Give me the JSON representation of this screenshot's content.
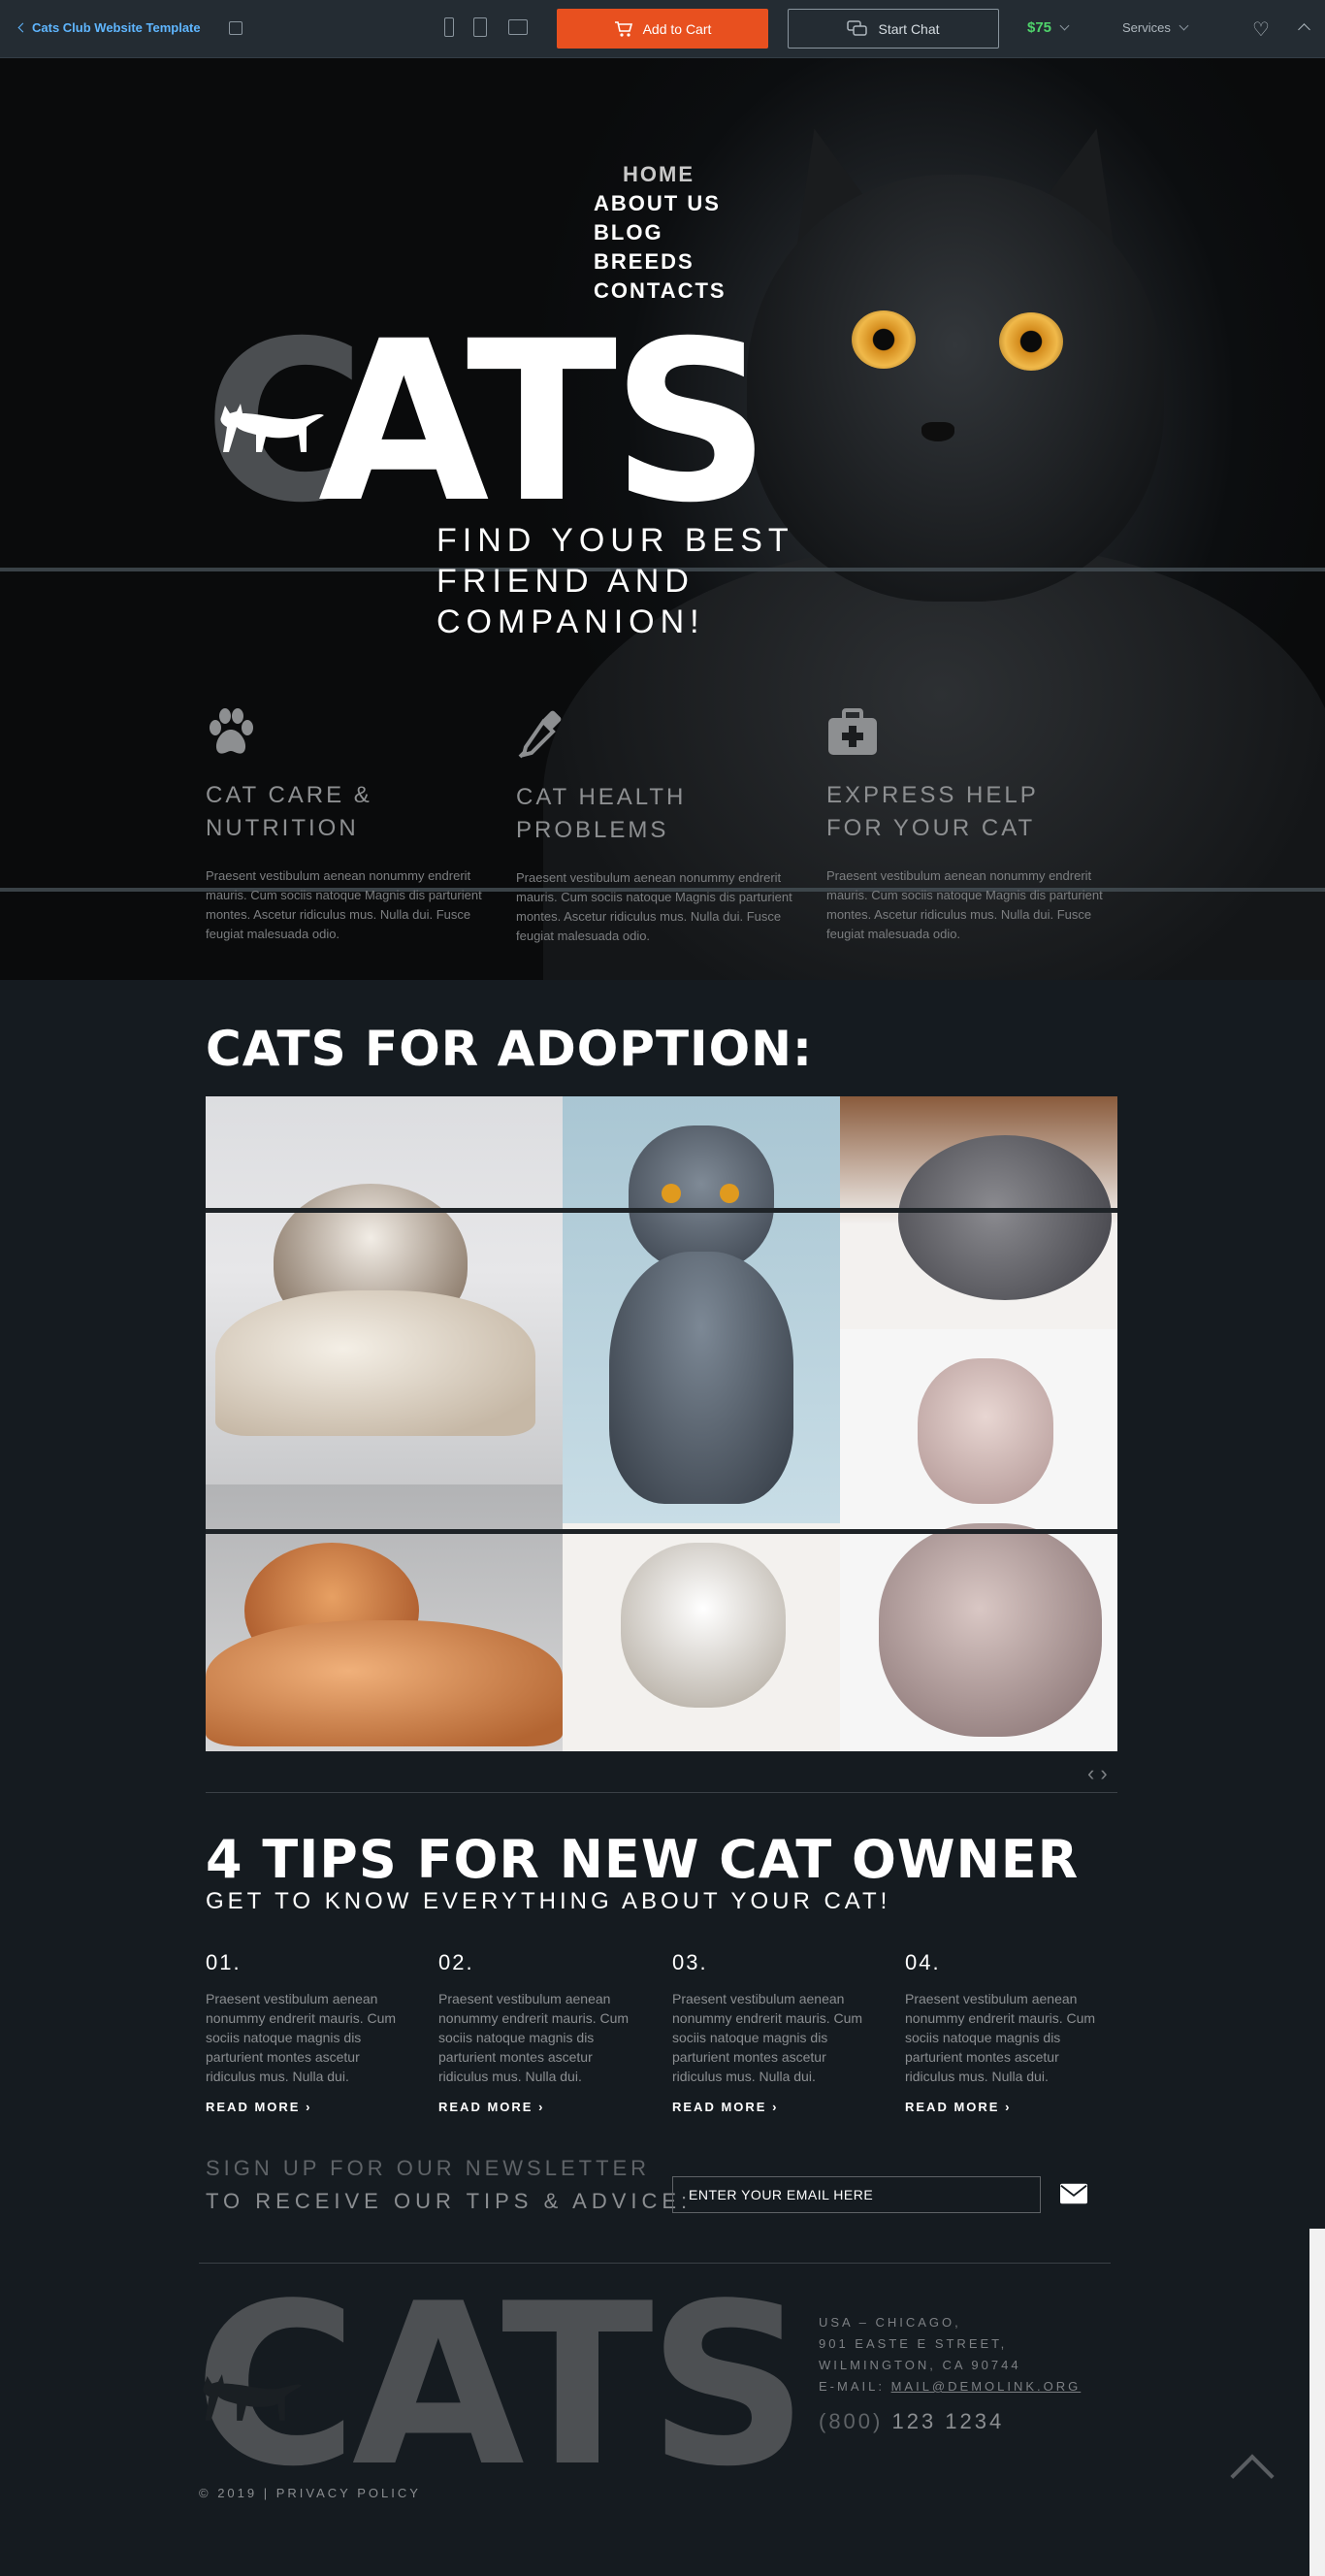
{
  "topbar": {
    "back_label": "Cats Club Website Template",
    "add_to_cart": "Add to Cart",
    "start_chat": "Start Chat",
    "price": "$75",
    "services": "Services"
  },
  "nav": {
    "items": [
      "HOME",
      "ABOUT US",
      "BLOG",
      "BREEDS",
      "CONTACTS"
    ]
  },
  "hero": {
    "logo_text": "ATS",
    "logo_initial": "C",
    "tagline": [
      "FIND YOUR BEST",
      "FRIEND AND",
      "COMPANION!"
    ]
  },
  "features": [
    {
      "icon": "paw-icon",
      "title": [
        "CAT CARE &",
        "NUTRITION"
      ],
      "text": "Praesent vestibulum aenean nonummy endrerit mauris. Cum sociis natoque Magnis dis parturient montes. Ascetur ridiculus mus. Nulla dui. Fusce feugiat malesuada odio."
    },
    {
      "icon": "dropper-icon",
      "title": [
        "CAT HEALTH",
        "PROBLEMS"
      ],
      "text": "Praesent vestibulum aenean nonummy endrerit mauris. Cum sociis natoque Magnis dis parturient montes. Ascetur ridiculus mus. Nulla dui. Fusce feugiat malesuada odio."
    },
    {
      "icon": "medkit-icon",
      "title": [
        "EXPRESS HELP",
        "FOR YOUR CAT"
      ],
      "text": "Praesent vestibulum aenean nonummy endrerit mauris. Cum sociis natoque Magnis dis parturient montes. Ascetur ridiculus mus. Nulla dui. Fusce feugiat malesuada odio."
    }
  ],
  "adoption": {
    "title": "CATS FOR ADOPTION:"
  },
  "tips": {
    "title": "4 TIPS FOR NEW CAT OWNER",
    "subtitle": "GET TO KNOW EVERYTHING ABOUT YOUR CAT!",
    "read_more": "READ MORE",
    "items": [
      {
        "num": "01.",
        "text": "Praesent vestibulum aenean nonummy endrerit mauris. Cum sociis natoque magnis dis parturient montes ascetur ridiculus mus. Nulla dui."
      },
      {
        "num": "02.",
        "text": "Praesent vestibulum aenean nonummy endrerit mauris. Cum sociis natoque magnis dis parturient montes ascetur ridiculus mus. Nulla dui."
      },
      {
        "num": "03.",
        "text": "Praesent vestibulum aenean nonummy endrerit mauris. Cum sociis natoque magnis dis parturient montes ascetur ridiculus mus. Nulla dui."
      },
      {
        "num": "04.",
        "text": "Praesent vestibulum aenean nonummy endrerit mauris. Cum sociis natoque magnis dis parturient montes ascetur ridiculus mus. Nulla dui."
      }
    ]
  },
  "newsletter": {
    "line1": "SIGN UP FOR OUR NEWSLETTER",
    "line2": "TO RECEIVE OUR TIPS & ADVICE:",
    "placeholder": "ENTER YOUR EMAIL HERE"
  },
  "footer": {
    "logo": "CATS",
    "address": [
      "USA – CHICAGO,",
      "901 EASTE E STREET,",
      "WILMINGTON, CA 90744"
    ],
    "email_label": "E-MAIL:",
    "email": "MAIL@DEMOLINK.ORG",
    "phone_code": "(800)",
    "phone": "123 1234",
    "copyright": "© 2019 | PRIVACY POLICY"
  },
  "colors": {
    "accent": "#e8501f",
    "price": "#4fd36b",
    "link": "#5fb6ff"
  }
}
